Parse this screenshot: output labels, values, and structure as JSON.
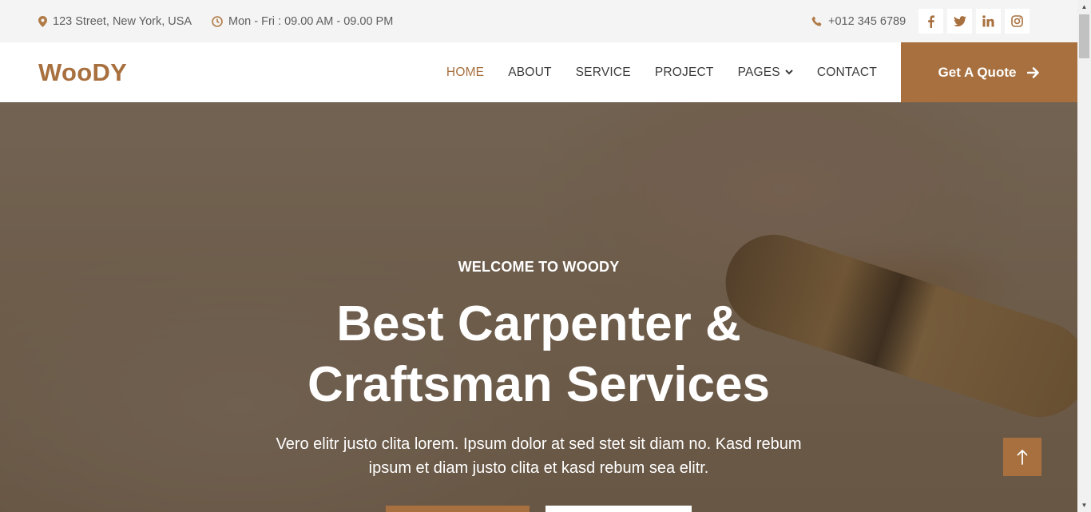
{
  "topbar": {
    "address": "123 Street, New York, USA",
    "hours": "Mon - Fri : 09.00 AM - 09.00 PM",
    "phone": "+012 345 6789",
    "address_icon": "map-marker-icon",
    "hours_icon": "clock-icon",
    "phone_icon": "phone-icon",
    "socials": [
      {
        "name": "facebook-icon",
        "glyph": "f"
      },
      {
        "name": "twitter-icon",
        "glyph": ""
      },
      {
        "name": "linkedin-icon",
        "glyph": "in"
      },
      {
        "name": "instagram-icon",
        "glyph": ""
      }
    ]
  },
  "navbar": {
    "brand": "WooDY",
    "links": [
      {
        "label": "HOME",
        "active": true
      },
      {
        "label": "ABOUT"
      },
      {
        "label": "SERVICE"
      },
      {
        "label": "PROJECT"
      },
      {
        "label": "PAGES",
        "dropdown": true
      },
      {
        "label": "CONTACT"
      }
    ],
    "quote_label": "Get A Quote"
  },
  "hero": {
    "subtitle": "WELCOME TO WOODY",
    "title_line1": "Best Carpenter &",
    "title_line2": "Craftsman Services",
    "text_line1": "Vero elitr justo clita lorem. Ipsum dolor at sed stet sit diam no. Kasd rebum",
    "text_line2": "ipsum et diam justo clita et kasd rebum sea elitr."
  },
  "colors": {
    "accent": "#a8703f",
    "topbar_bg": "#f4f4f4",
    "nav_text": "#3c3c3c"
  }
}
